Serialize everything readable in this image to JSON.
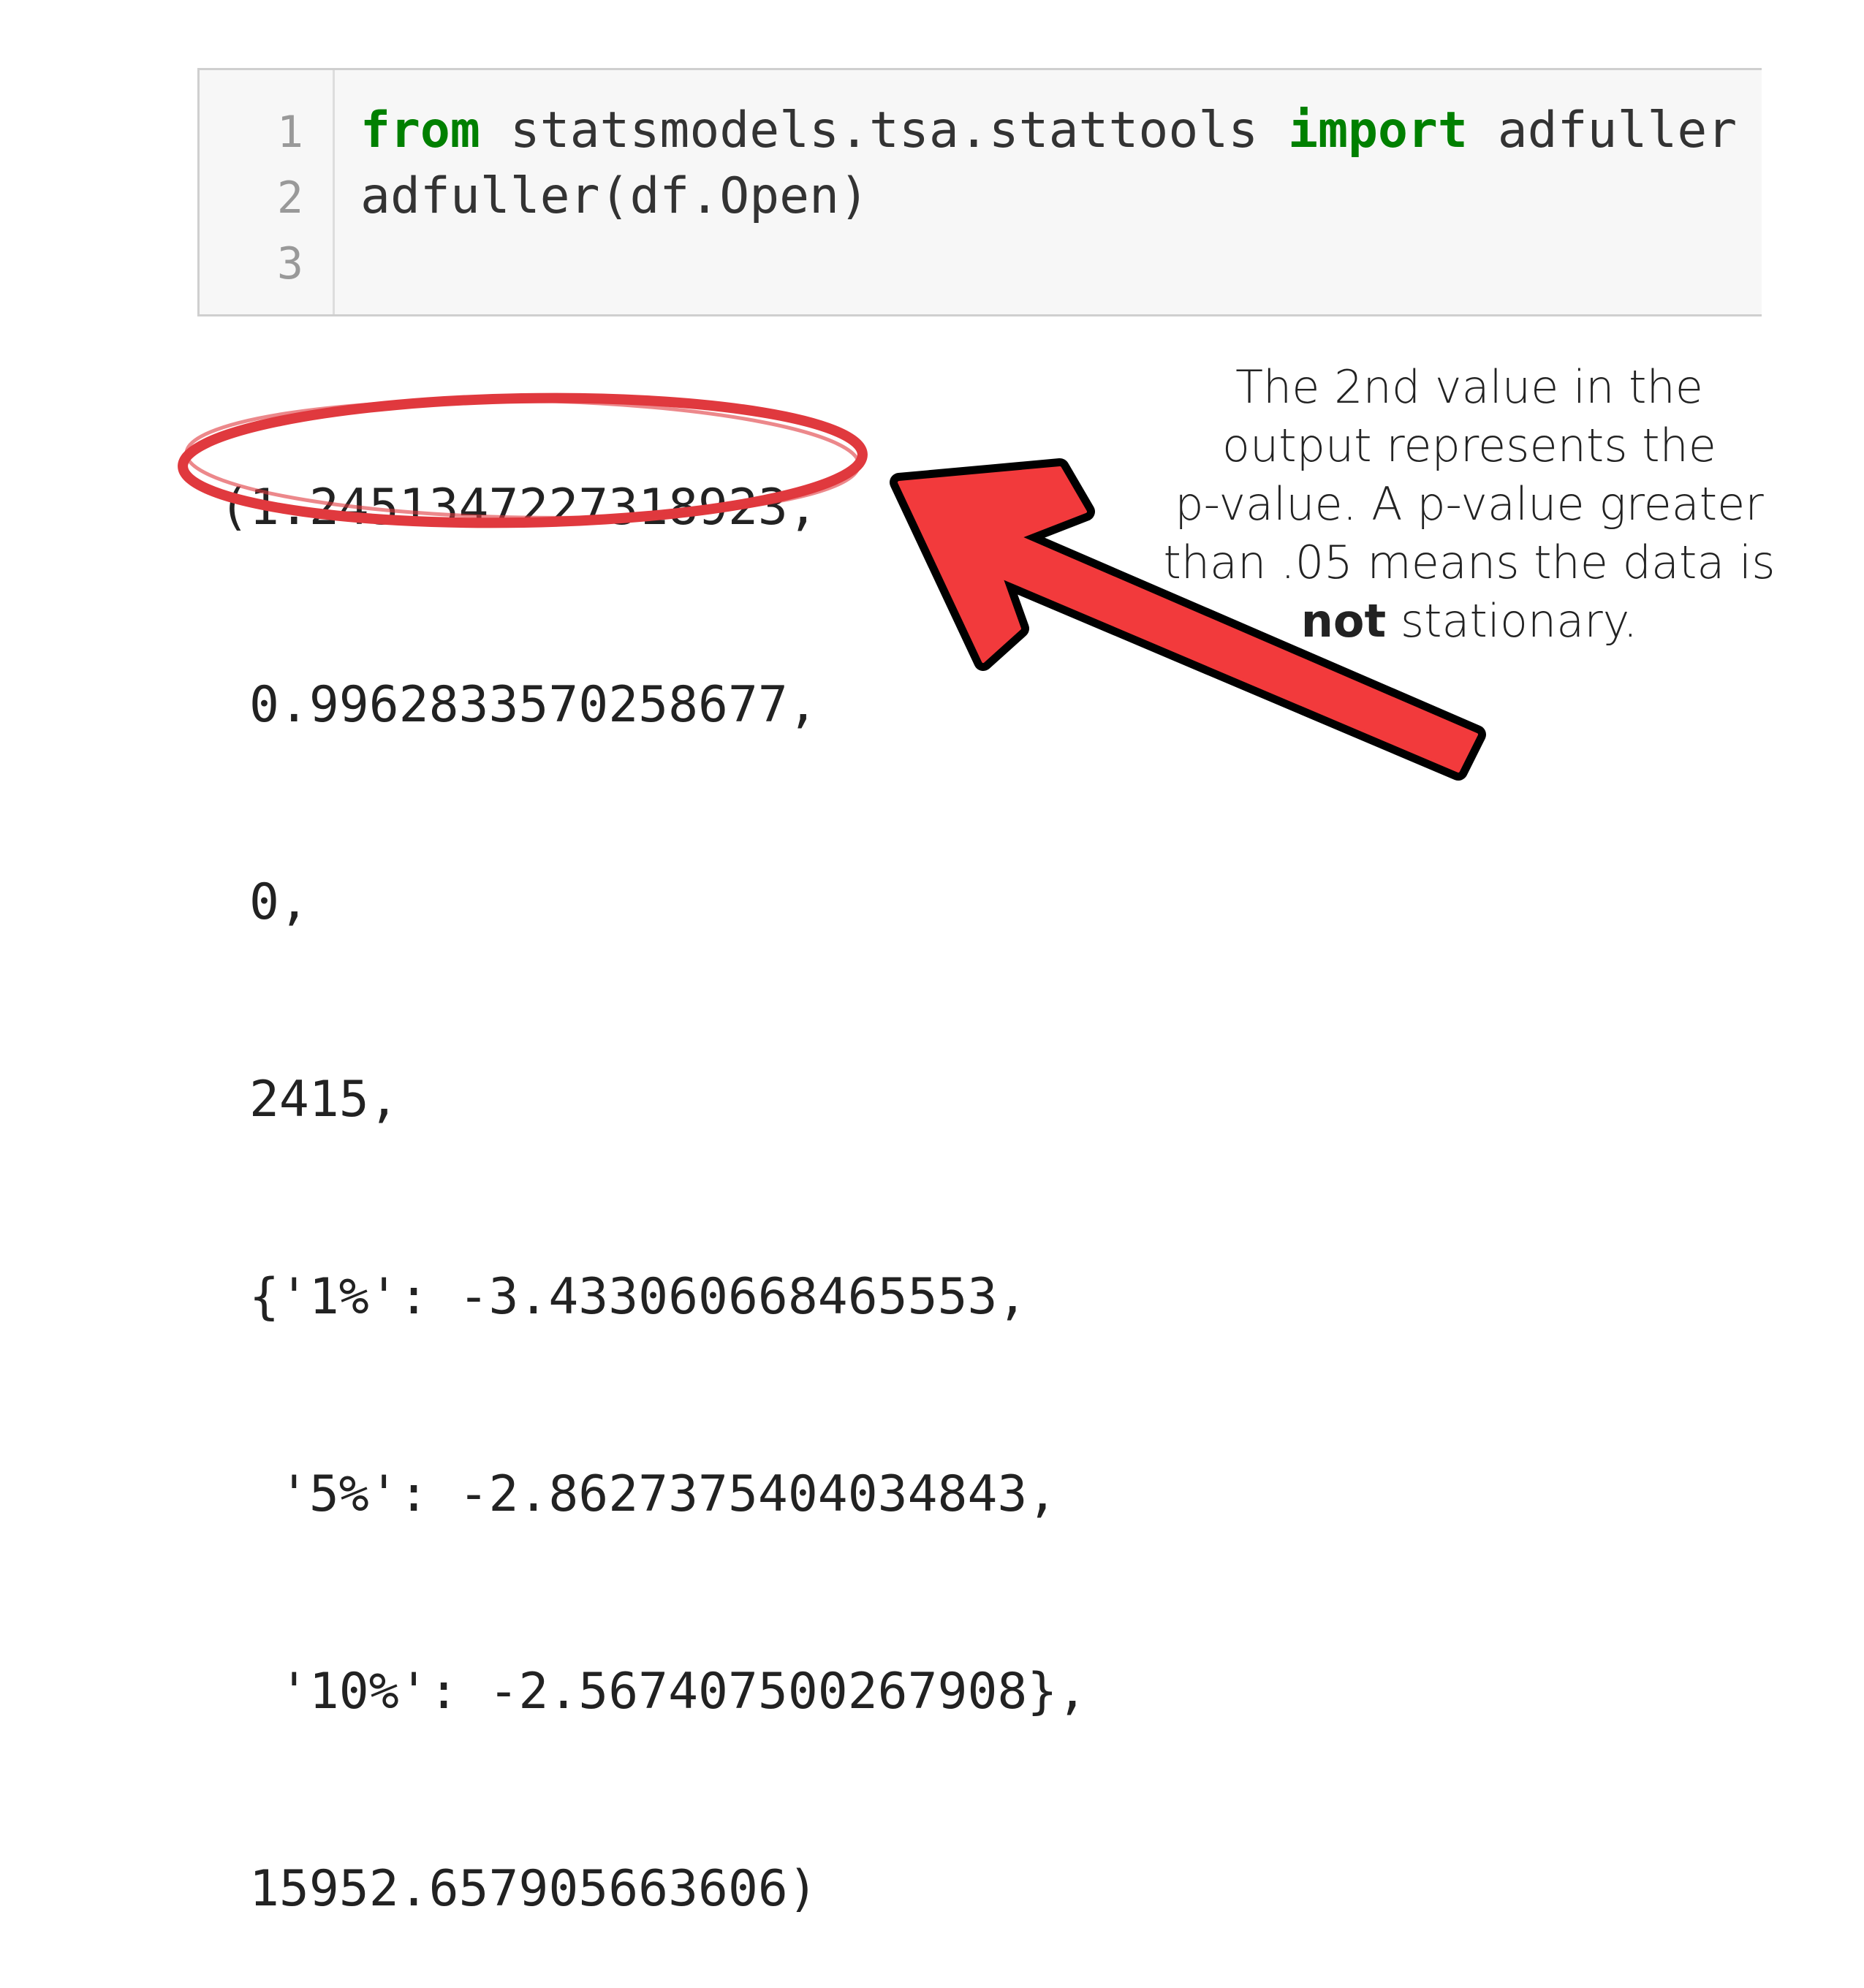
{
  "code_cell": {
    "line_numbers": [
      "1",
      "2",
      "3"
    ],
    "line1": {
      "kw_from": "from",
      "module": " statsmodels.tsa.stattools ",
      "kw_import": "import",
      "name": " adfuller"
    },
    "line2": "adfuller(df.Open)",
    "line3": ""
  },
  "output_lines": [
    "(1.2451347227318923,",
    " 0.9962833570258677,",
    " 0,",
    " 2415,",
    " {'1%': -3.433060668465553,",
    "  '5%': -2.8627375404034843,",
    "  '10%': -2.567407500267908},",
    " 15952.657905663606)"
  ],
  "annotation": {
    "line1": "The 2nd value in the",
    "line2": "output represents the",
    "line3": "p-value.  A p-value greater",
    "line4": "than .05 means the data is",
    "line5_bold": "not",
    "line5_rest": " stationary."
  },
  "colors": {
    "keyword": "#008000",
    "highlight_circle": "#e0393e",
    "arrow_fill": "#f23a3c",
    "arrow_outline": "#000000"
  },
  "icons": {
    "circle": "highlight-ellipse",
    "arrow": "pointer-arrow"
  }
}
